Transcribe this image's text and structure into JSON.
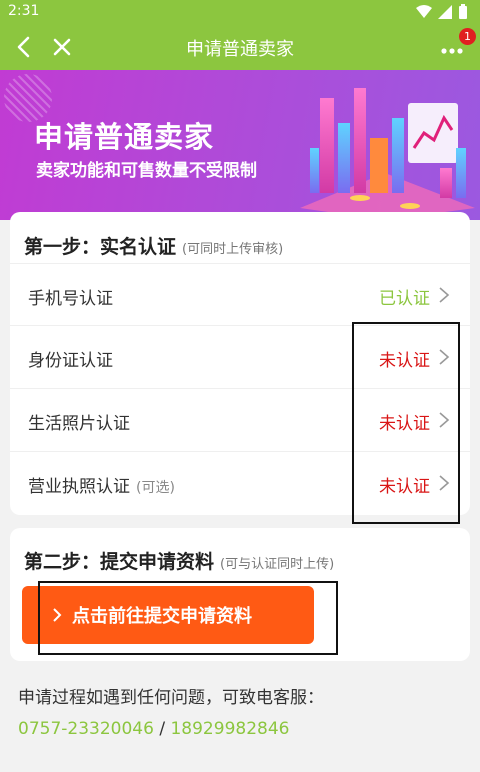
{
  "status_bar": {
    "time": "2:31"
  },
  "header": {
    "title": "申请普通卖家",
    "badge_count": "1",
    "icons": [
      "back-arrow-icon",
      "close-icon",
      "more-icon"
    ]
  },
  "banner": {
    "title": "申请普通卖家",
    "subtitle": "卖家功能和可售数量不受限制"
  },
  "step1": {
    "title": "第一步：实名认证",
    "note": "(可同时上传审核)",
    "rows": [
      {
        "label": "手机号认证",
        "optional": "",
        "status": "已认证",
        "verified": true
      },
      {
        "label": "身份证认证",
        "optional": "",
        "status": "未认证",
        "verified": false
      },
      {
        "label": "生活照片认证",
        "optional": "",
        "status": "未认证",
        "verified": false
      },
      {
        "label": "营业执照认证",
        "optional": "(可选)",
        "status": "未认证",
        "verified": false
      }
    ]
  },
  "step2": {
    "title": "第二步：提交申请资料",
    "note": "(可与认证同时上传)",
    "button_label": "点击前往提交申请资料"
  },
  "footer": {
    "contact_text": "申请过程如遇到任何问题，可致电客服：",
    "phone1": "0757-23320046",
    "separator": " / ",
    "phone2": "18929982846"
  },
  "colors": {
    "brand_green": "#8cc63f",
    "unverified_red": "#d91616",
    "button_orange": "#ff5a14",
    "banner_purple": "#b04ad8"
  }
}
